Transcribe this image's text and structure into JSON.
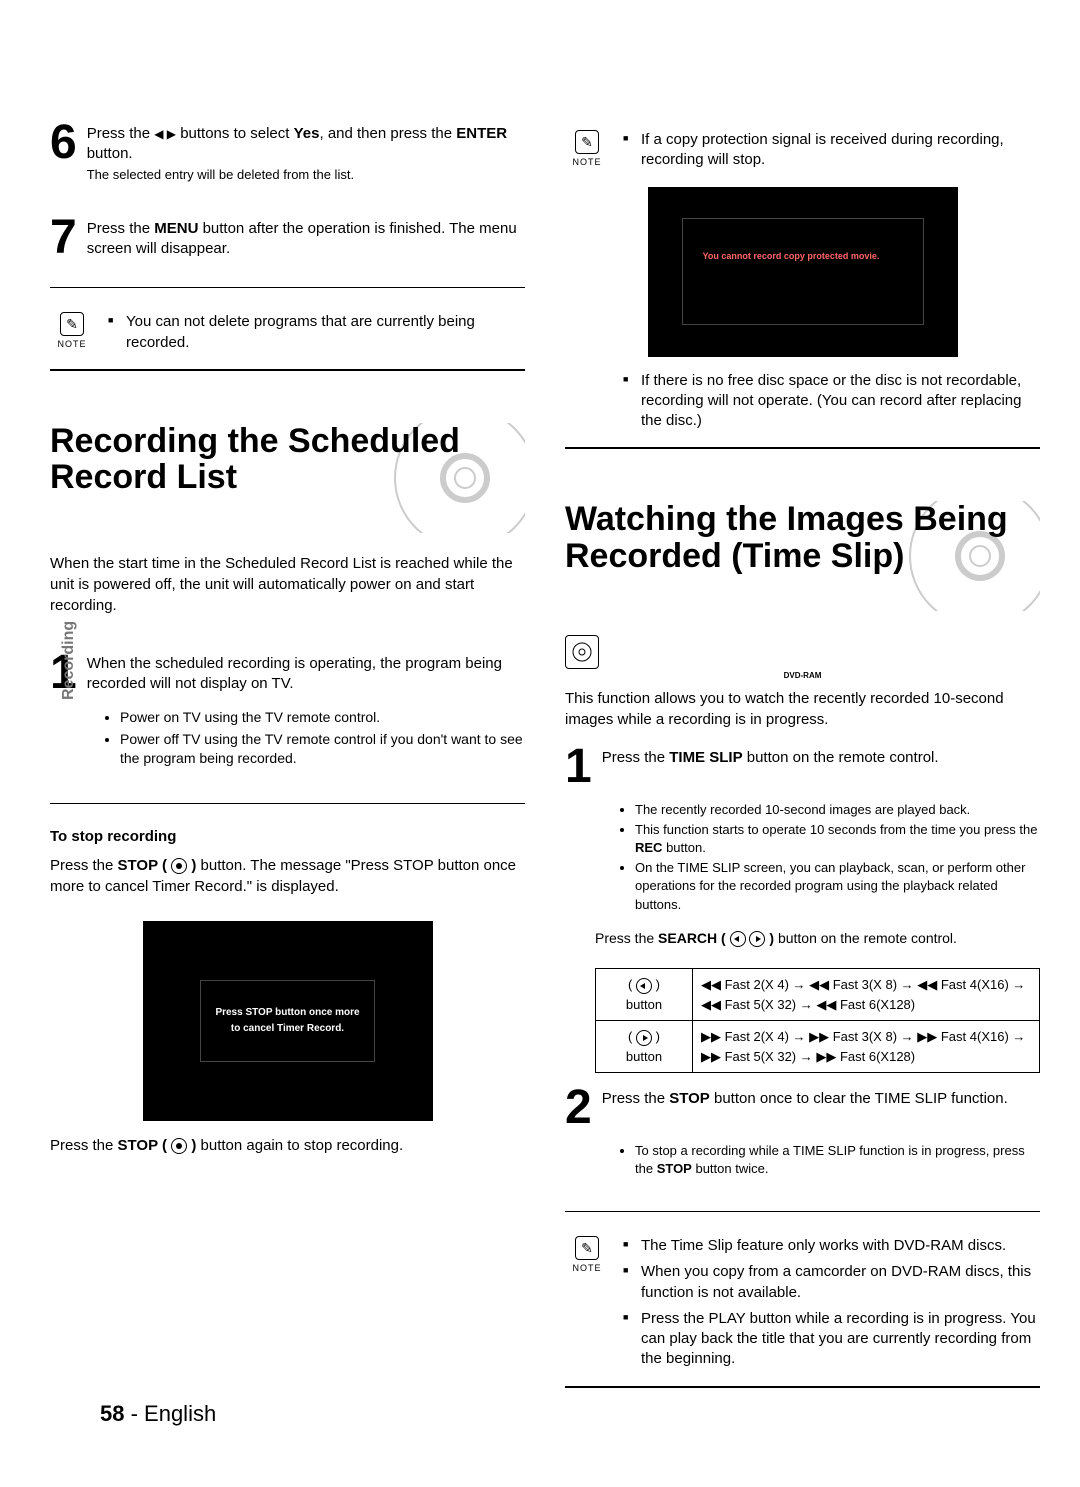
{
  "step6": {
    "pre": "Press the ",
    "mid": " buttons to select ",
    "yes": "Yes",
    "post": ", and then press the ",
    "enter": "ENTER",
    "tail": " button.",
    "sub": "The selected entry will be deleted from the list."
  },
  "step7": {
    "pre": "Press the ",
    "menu": "MENU",
    "post": " button after the operation is finished. The menu screen will disappear."
  },
  "noteL1": "You can not delete programs that are currently being recorded.",
  "noteLabel": "NOTE",
  "headingL": "Recording the Scheduled Record List",
  "introL": "When the start time in the Scheduled Record List is reached while the unit is powered off, the unit will automatically power on and start recording.",
  "recLabel": "Recording",
  "stepL1": "When the scheduled recording is operating, the program being recorded will not display on TV.",
  "stepL1b1": "Power on TV using the TV remote control.",
  "stepL1b2": "Power off TV using the TV remote control if you don't want to see the program being recorded.",
  "stopH": "To stop recording",
  "stopP1a": "Press the ",
  "stopP1b": "STOP ( ",
  "stopP1c": " ) ",
  "stopP1d": "button. The message \"Press STOP button once more to cancel Timer Record.\" is displayed.",
  "screenStop1": "Press STOP button once more",
  "screenStop2": "to cancel Timer Record.",
  "stopP2a": "Press the ",
  "stopP2b": "STOP ( ",
  "stopP2c": " ) ",
  "stopP2d": "button again to stop recording.",
  "noteR1": "If a copy protection signal is received during recording, recording will stop.",
  "screenProt": "You cannot record copy protected movie.",
  "noteR2": "If there is no free disc space or the disc is not recordable, recording will not operate. (You can record after replacing the disc.)",
  "headingR": "Watching the Images Being Recorded (Time Slip)",
  "ramLabel": "DVD-RAM",
  "introR": "This function allows you to watch the recently recorded 10-second images while a recording is in progress.",
  "stepR1a": "Press the ",
  "stepR1b": "TIME SLIP",
  "stepR1c": " button on the remote control.",
  "stepR1bul1": "The recently recorded 10-second images are played back.",
  "stepR1bul2": "This function starts to operate 10 seconds from the time you press the REC button.",
  "stepR1bul2b": "REC",
  "stepR1bul3": "On the TIME SLIP screen, you can playback, scan, or perform other operations for the recorded program using the playback related buttons.",
  "searchA": "Press the ",
  "searchB": "SEARCH ( ",
  "searchC": " ) ",
  "searchD": "button on the remote control.",
  "tbl_btn": "button",
  "speed_rw": "◀◀ Fast 2(X 4) → ◀◀ Fast 3(X 8) → ◀◀ Fast 4(X16) → ◀◀ Fast 5(X 32) → ◀◀ Fast 6(X128)",
  "speed_ff": "▶▶ Fast 2(X 4) → ▶▶ Fast 3(X 8) → ▶▶ Fast 4(X16) → ▶▶ Fast 5(X 32) → ▶▶ Fast 6(X128)",
  "stepR2a": "Press the ",
  "stepR2b": "STOP",
  "stepR2c": " button once to clear the TIME SLIP function.",
  "stepR2bul": "To stop a recording while a TIME SLIP function is in progress, press the STOP button twice.",
  "stepR2bulB": "STOP",
  "noteB1": "The Time Slip feature only works with DVD-RAM discs.",
  "noteB2": "When you copy from a camcorder on DVD-RAM discs, this function is not available.",
  "noteB3": "Press the PLAY button while a recording is in progress. You can play back the title that you are currently recording from the beginning.",
  "pageNum": "58",
  "pageLang": " - English"
}
